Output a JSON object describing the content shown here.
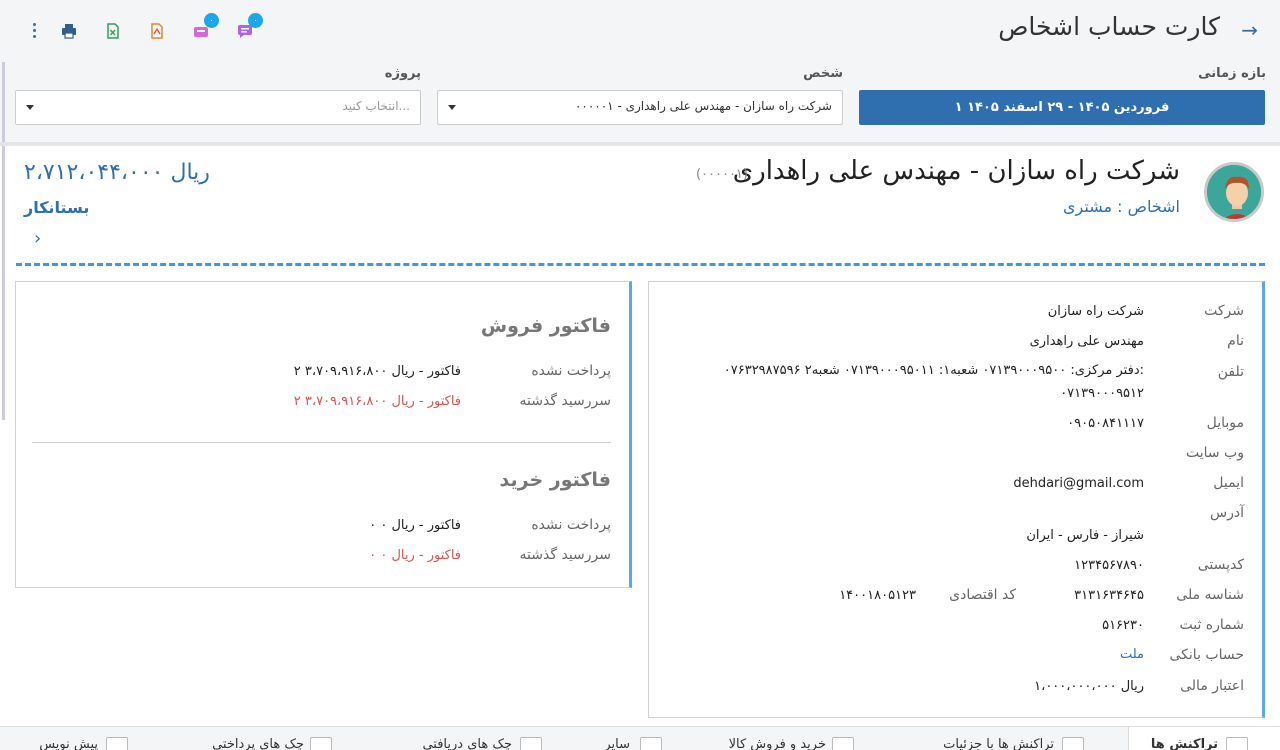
{
  "header": {
    "title": "کارت حساب اشخاص",
    "badges": {
      "messages": "۰",
      "notifications": "۰"
    }
  },
  "filters": {
    "date_label": "بازه زمانی",
    "date_value": "۱ فروردین ۱۴۰۵ - ۲۹ اسفند ۱۴۰۵",
    "person_label": "شخص",
    "person_value": "۰۰۰۰۰۱ - شرکت راه سازان - مهندس علی راهداری",
    "project_label": "پروژه",
    "project_placeholder": "انتخاب کنید..."
  },
  "person": {
    "name": "شرکت راه سازان - مهندس علی راهداری",
    "code": "(۰۰۰۰۰۱)",
    "type": "اشخاص : مشتری",
    "balance": "ریال ۲،۷۱۲،۰۴۴،۰۰۰",
    "balance_status": "بستانکار"
  },
  "info": {
    "company_label": "شرکت",
    "company": "شرکت راه سازان",
    "name_label": "نام",
    "name": "مهندس علی راهداری",
    "phone_label": "تلفن",
    "phone_line1": "۰۷۶۳۲۹۸۷۵۹۶ دفتر مرکزی: ۰۷۱۳۹۰۰۰۹۵۰۰ شعبه۱: ۰۷۱۳۹۰۰۰۹۵۰۱۱ شعبه۲:",
    "phone_line2": "۰۷۱۳۹۰۰۰۹۵۱۲",
    "mobile_label": "موبایل",
    "mobile": "۰۹۰۵۰۸۴۱۱۱۷",
    "website_label": "وب سایت",
    "email_label": "ایمیل",
    "email": "dehdari@gmail.com",
    "address_label": "آدرس",
    "address": "شیراز - فارس - ایران",
    "postal_label": "کدپستی",
    "postal": "۱۲۳۴۵۶۷۸۹۰",
    "national_label": "شناسه ملی",
    "national": "۳۱۳۱۶۳۴۶۴۵",
    "economic_label": "کد اقتصادی",
    "economic": "۱۴۰۰۱۸۰۵۱۲۳",
    "reg_label": "شماره ثبت",
    "reg": "۵۱۶۲۳۰",
    "bank_label": "حساب بانکی",
    "bank": "ملت",
    "credit_label": "اعتبار مالی",
    "credit": "ریال ۱،۰۰۰،۰۰۰،۰۰۰"
  },
  "invoices": {
    "sales_title": "فاکتور فروش",
    "purchase_title": "فاکتور خرید",
    "unpaid_label": "پرداخت نشده",
    "overdue_label": "سررسید گذشته",
    "sales_unpaid": "۲ فاکتور - ریال ۳،۷۰۹،۹۱۶،۸۰۰",
    "sales_overdue": "۲ فاکتور - ریال ۳،۷۰۹،۹۱۶،۸۰۰",
    "purchase_unpaid": "۰ فاکتور - ریال ۰",
    "purchase_overdue": "۰ فاکتور - ریال ۰"
  },
  "tabs": [
    "تراکنش ها",
    "تراکنش ها با جزئیات",
    "خرید و فروش کالا",
    "سایر",
    "چک های دریافتی",
    "چک های پرداختی",
    "پیش نویس"
  ],
  "colors": {
    "accent": "#2f6fb0",
    "card_edge": "#5aa8ea",
    "overdue": "#d9534f"
  }
}
